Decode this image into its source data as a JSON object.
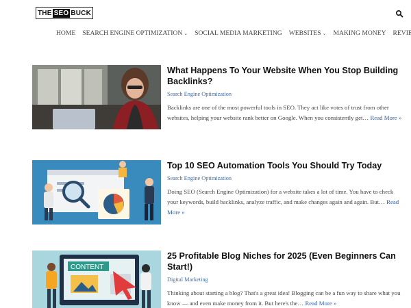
{
  "header": {
    "logo": {
      "left": "THE",
      "middle": "SEO",
      "right": "BUCK"
    },
    "search_icon": "search-icon"
  },
  "nav": [
    {
      "label": "HOME",
      "dropdown": false
    },
    {
      "label": "SEARCH ENGINE OPTIMIZATION",
      "dropdown": true
    },
    {
      "label": "SOCIAL MEDIA MARKETING",
      "dropdown": false
    },
    {
      "label": "WEBSITES",
      "dropdown": true
    },
    {
      "label": "MAKING MONEY",
      "dropdown": false
    },
    {
      "label": "REVIEWS",
      "dropdown": false
    }
  ],
  "posts": [
    {
      "title": "What Happens To Your Website When You Stop Building Backlinks?",
      "category": "Search Engine Optimization",
      "excerpt": "Backlinks are one of the most powerful tools in SEO. They act like votes of trust from other websites, helping your website rank better on Google. When you consistently get…",
      "read_more": "Read More »"
    },
    {
      "title": "Top 10 SEO Automation Tools You Should Try Today",
      "category": "Search Engine Optimization",
      "excerpt": "Doing SEO (Search Engine Optimization) for a website takes a lot of time. You have to check your keywords, build backlinks, analyze traffic, and make changes again and again. But…",
      "read_more": "Read More »"
    },
    {
      "title": "25 Profitable Blog Niches for 2025 (Even Beginners Can Start!)",
      "category": "Digital Marketing",
      "excerpt": "Thinking about starting a blog? That's a great idea! Blogging can be a fun way to share what you know — and even make money from it. But here's the…",
      "read_more": "Read More »",
      "thumb_text": "CONTENT"
    }
  ]
}
